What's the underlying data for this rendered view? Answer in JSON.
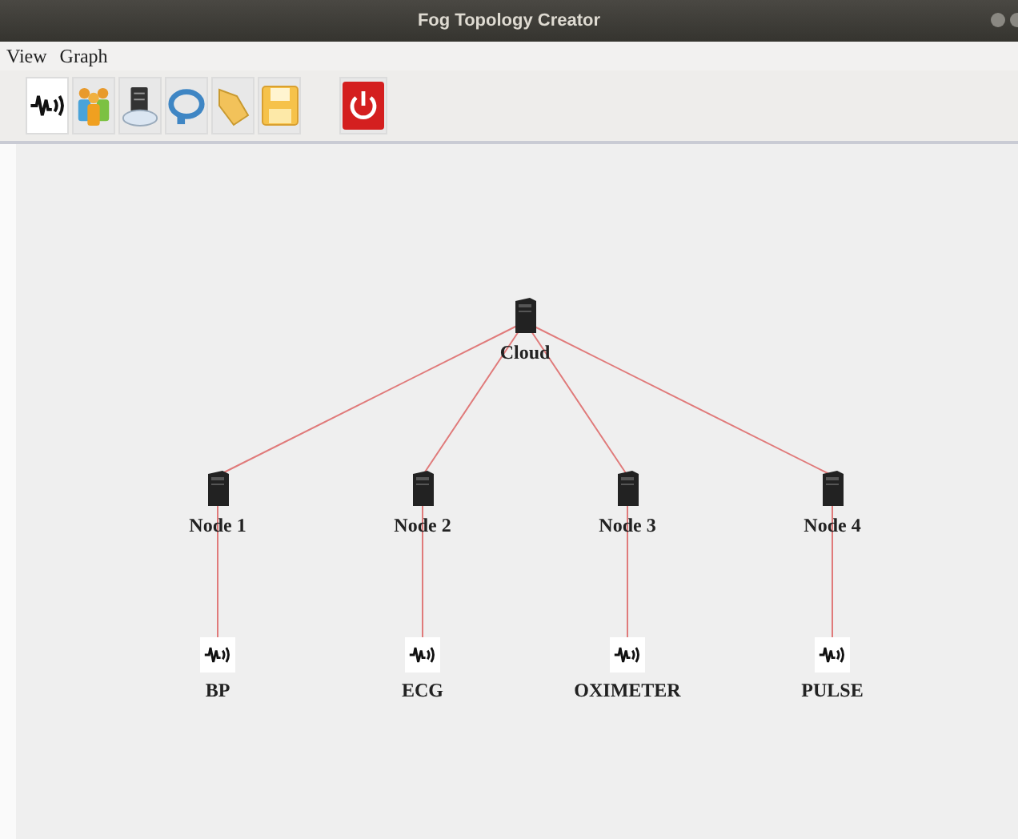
{
  "window": {
    "title": "Fog Topology Creator"
  },
  "menu": [
    {
      "label": "View"
    },
    {
      "label": "Graph"
    }
  ],
  "toolbar": [
    {
      "kind": "sensor",
      "selected": true
    },
    {
      "kind": "actuator",
      "selected": false
    },
    {
      "kind": "fog-device",
      "selected": false
    },
    {
      "kind": "link",
      "selected": false
    },
    {
      "kind": "open",
      "selected": false
    },
    {
      "kind": "save",
      "selected": false
    },
    {
      "kind": "exit",
      "selected": false
    }
  ],
  "graph": {
    "root": {
      "kind": "server",
      "label": "Cloud",
      "children": [
        {
          "kind": "server",
          "label": "Node 1",
          "children": [
            {
              "kind": "sensor",
              "label": "BP"
            }
          ]
        },
        {
          "kind": "server",
          "label": "Node 2",
          "children": [
            {
              "kind": "sensor",
              "label": "ECG"
            }
          ]
        },
        {
          "kind": "server",
          "label": "Node 3",
          "children": [
            {
              "kind": "sensor",
              "label": "OXIMETER"
            }
          ]
        },
        {
          "kind": "server",
          "label": "Node 4",
          "children": [
            {
              "kind": "sensor",
              "label": "PULSE"
            }
          ]
        }
      ]
    }
  }
}
